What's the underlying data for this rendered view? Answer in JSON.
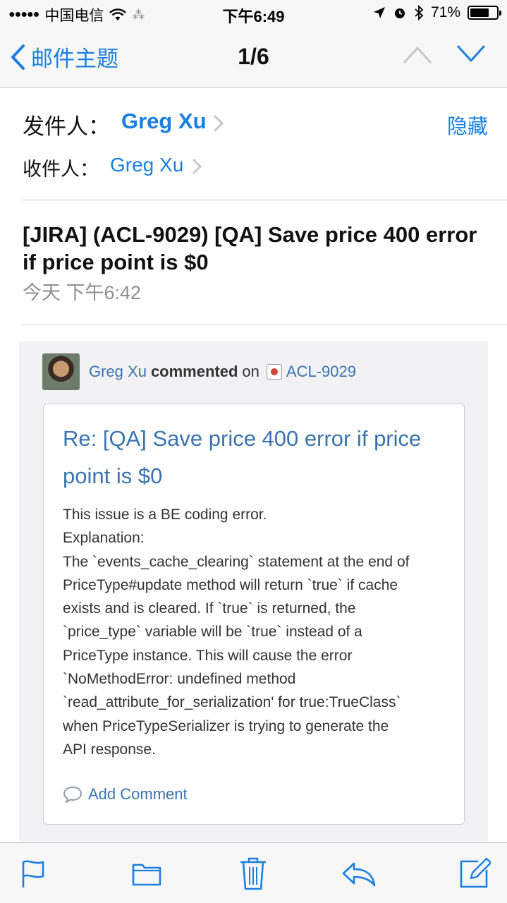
{
  "status_bar": {
    "signal": "●●●●●",
    "carrier": "中国电信",
    "loading": "⁂",
    "time": "下午6:49",
    "battery": "71%",
    "battery_level": 0.71
  },
  "nav": {
    "back_label": "邮件主题",
    "counter": "1/6"
  },
  "header": {
    "from_label": "发件人：",
    "from_name": "Greg Xu",
    "hide_label": "隐藏",
    "to_label": "收件人：",
    "to_name": "Greg Xu"
  },
  "message": {
    "subject": "[JIRA] (ACL-9029) [QA] Save price 400 error if price point is $0",
    "date": "今天 下午6:42"
  },
  "jira": {
    "commenter": "Greg Xu",
    "action": "commented",
    "preposition": "on",
    "issue_key": "ACL-9029",
    "title": "Re: [QA] Save price 400 error if price point is $0",
    "body_lines": [
      "This issue is a BE coding error.",
      "Explanation:",
      "The `events_cache_clearing` statement at the end of",
      "PriceType#update method will return `true` if cache",
      "exists and is cleared. If `true` is returned, the",
      "`price_type` variable will be `true` instead of a",
      "PriceType instance. This will cause the error",
      "`NoMethodError: undefined method",
      "`read_attribute_for_serialization' for true:TrueClass`",
      "when PriceTypeSerializer is trying to generate the",
      "API response."
    ],
    "add_comment": "Add Comment"
  },
  "toolbar": {
    "icons": [
      "flag-icon",
      "folder-icon",
      "trash-icon",
      "reply-icon",
      "compose-icon"
    ]
  },
  "colors": {
    "ios_blue": "#1a7fe0",
    "jira_link": "#3b73af",
    "muted_gray": "#8e8e93"
  }
}
